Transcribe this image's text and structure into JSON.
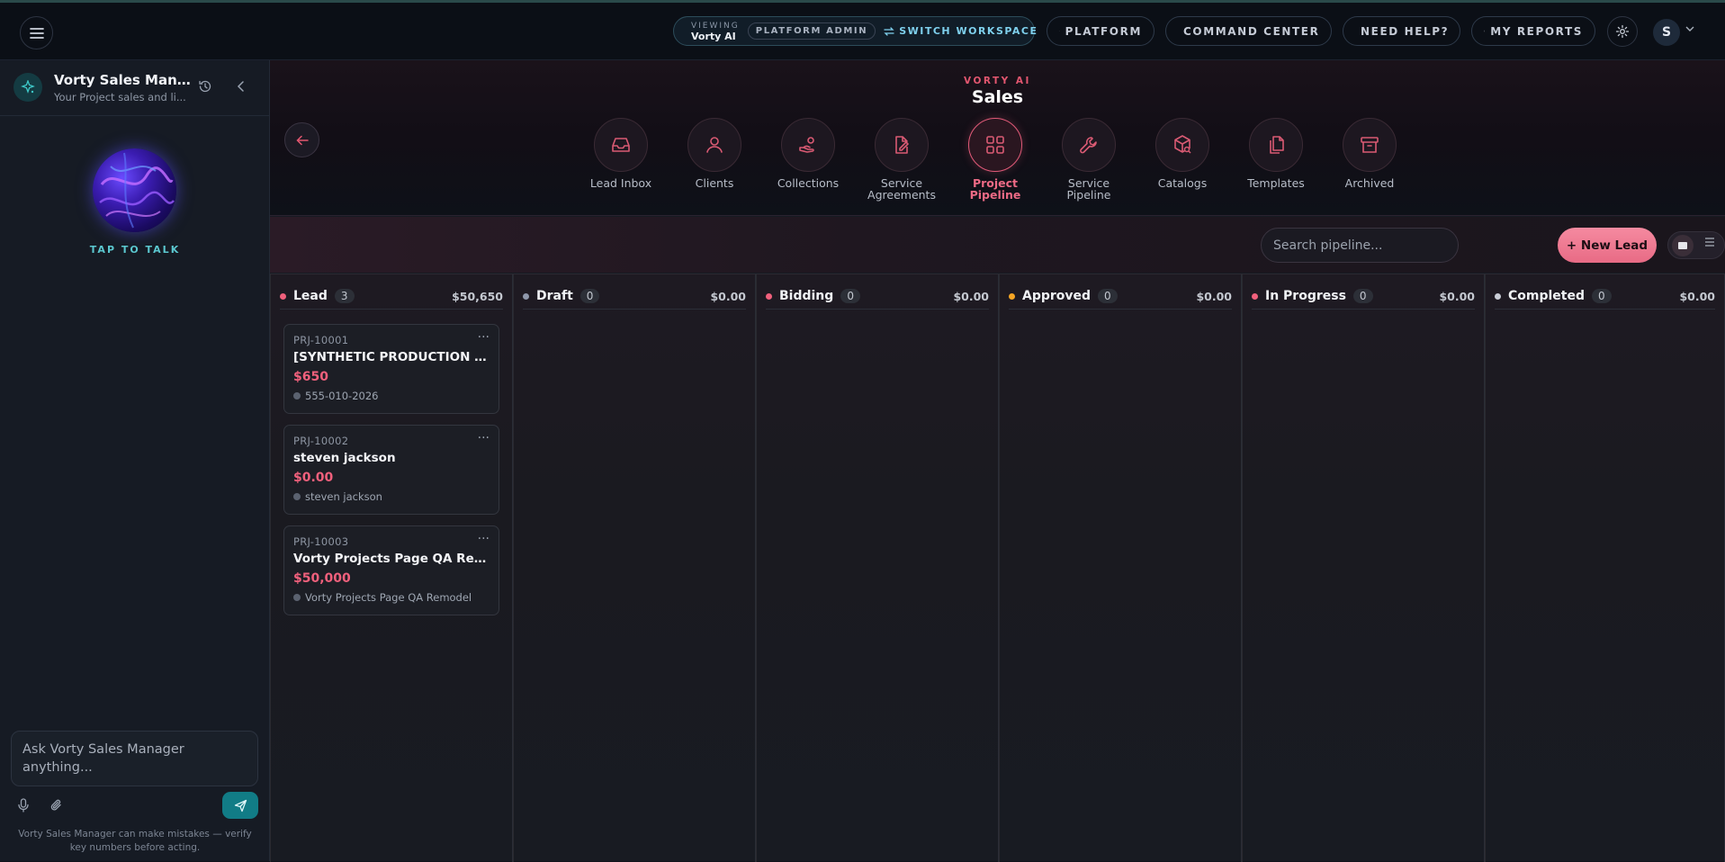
{
  "topbar": {
    "viewing_label": "VIEWING",
    "viewing_workspace": "Vorty AI",
    "admin_badge": "PLATFORM ADMIN",
    "switch_workspace": "SWITCH WORKSPACE",
    "platform": "PLATFORM",
    "command_center": "COMMAND CENTER",
    "need_help": "NEED HELP?",
    "my_reports": "MY REPORTS",
    "avatar_initial": "S"
  },
  "sidebar": {
    "title": "Vorty Sales Mana...",
    "subtitle": "Your Project sales and li...",
    "tap_to_talk": "TAP TO TALK",
    "chat_placeholder": "Ask Vorty Sales Manager anything...",
    "disclaimer": "Vorty Sales Manager can make mistakes — verify key numbers before acting."
  },
  "module": {
    "eyebrow": "VORTY AI",
    "title": "Sales",
    "nav": [
      {
        "label": "Lead Inbox",
        "icon": "inbox-icon"
      },
      {
        "label": "Clients",
        "icon": "users-icon"
      },
      {
        "label": "Collections",
        "icon": "hand-coins-icon"
      },
      {
        "label": "Service\nAgreements",
        "icon": "file-signature-icon"
      },
      {
        "label": "Project\nPipeline",
        "icon": "grid-icon",
        "active": true
      },
      {
        "label": "Service\nPipeline",
        "icon": "wrench-icon"
      },
      {
        "label": "Catalogs",
        "icon": "package-search-icon"
      },
      {
        "label": "Templates",
        "icon": "copy-icon"
      },
      {
        "label": "Archived",
        "icon": "archive-icon"
      }
    ]
  },
  "toolbar": {
    "search_placeholder": "Search pipeline...",
    "new_lead": "+ New Lead"
  },
  "colors": {
    "accent": "#e05a78",
    "lead": "#f0607c",
    "draft": "#8e97aa",
    "bidding": "#f0607c",
    "approved": "#f5a524",
    "in_progress": "#f0607c",
    "completed": "#c9cdd6"
  },
  "columns": [
    {
      "name": "Lead",
      "count": "3",
      "total": "$50,650",
      "cards": [
        {
          "id": "PRJ-10001",
          "title": "[SYNTHETIC PRODUCTION QA...",
          "amount": "$650",
          "meta": "555-010-2026"
        },
        {
          "id": "PRJ-10002",
          "title": "steven jackson",
          "amount": "$0.00",
          "meta": "steven jackson"
        },
        {
          "id": "PRJ-10003",
          "title": "Vorty Projects Page QA Remod...",
          "amount": "$50,000",
          "meta": "Vorty Projects Page QA Remodel"
        }
      ]
    },
    {
      "name": "Draft",
      "count": "0",
      "total": "$0.00",
      "cards": []
    },
    {
      "name": "Bidding",
      "count": "0",
      "total": "$0.00",
      "cards": []
    },
    {
      "name": "Approved",
      "count": "0",
      "total": "$0.00",
      "cards": []
    },
    {
      "name": "In Progress",
      "count": "0",
      "total": "$0.00",
      "cards": []
    },
    {
      "name": "Completed",
      "count": "0",
      "total": "$0.00",
      "cards": []
    }
  ]
}
